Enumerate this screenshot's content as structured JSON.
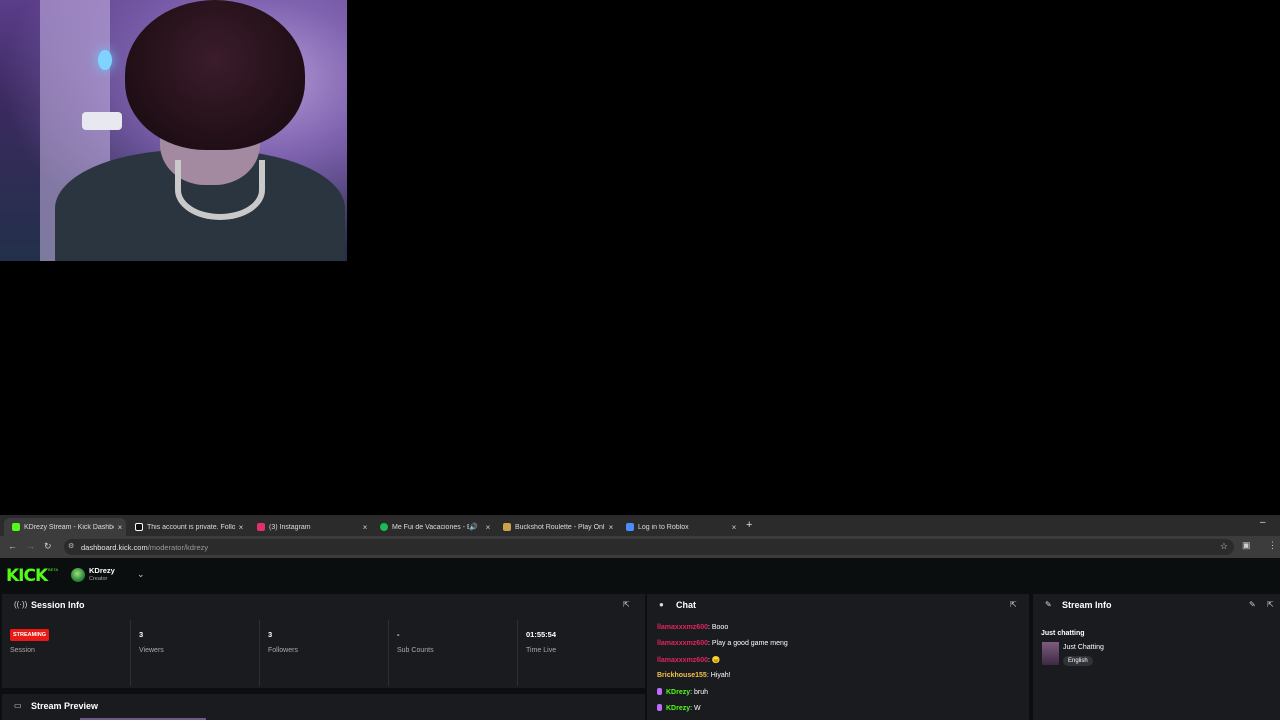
{
  "browser": {
    "tabs": [
      {
        "title": "KDrezy Stream - Kick Dashboard",
        "active": true,
        "favicon_color": "#53fc18"
      },
      {
        "title": "This account is private. Follow t",
        "active": false,
        "favicon_color": "#ffffff"
      },
      {
        "title": "(3) Instagram",
        "active": false,
        "favicon_color": "#e1306c"
      },
      {
        "title": "Me Fui de Vacaciones - Bad",
        "active": false,
        "favicon_color": "#1db954"
      },
      {
        "title": "Buckshot Roulette - Play Onli",
        "active": false,
        "favicon_color": "#c9a24a"
      },
      {
        "title": "Log in to Roblox",
        "active": false,
        "favicon_color": "#4a8cff"
      }
    ],
    "url_host": "dashboard.kick.com",
    "url_path": "/moderator/kdrezy",
    "close_glyph": "×"
  },
  "app": {
    "logo": "KICK",
    "logo_badge": "BETA",
    "user": {
      "name": "KDrezy",
      "role": "Creator"
    },
    "session_info": {
      "title": "Session Info",
      "status_badge": "STREAMING",
      "stats": [
        {
          "value": "",
          "label": "Session"
        },
        {
          "value": "3",
          "label": "Viewers"
        },
        {
          "value": "3",
          "label": "Followers"
        },
        {
          "value": "-",
          "label": "Sub Counts"
        },
        {
          "value": "01:55:54",
          "label": "Time Live"
        }
      ]
    },
    "stream_preview": {
      "title": "Stream Preview"
    },
    "chat": {
      "title": "Chat",
      "messages": [
        {
          "user": "llamaxxxmz600",
          "text": ": Booo",
          "color": "#e0245e",
          "mod": false
        },
        {
          "user": "llamaxxxmz600",
          "text": ": Play a good game meng",
          "color": "#e0245e",
          "mod": false
        },
        {
          "user": "llamaxxxmz600",
          "text": ": 😠",
          "color": "#e0245e",
          "mod": false
        },
        {
          "user": "Brickhouse155",
          "text": ": Hiyah!",
          "color": "#f3c24b",
          "mod": false
        },
        {
          "user": "KDrezy",
          "text": ": bruh",
          "color": "#53fc18",
          "mod": true
        },
        {
          "user": "KDrezy",
          "text": ": W",
          "color": "#53fc18",
          "mod": true
        }
      ]
    },
    "stream_info": {
      "title": "Stream Info",
      "category_heading": "Just chatting",
      "category": "Just Chatting",
      "language": "English"
    }
  }
}
